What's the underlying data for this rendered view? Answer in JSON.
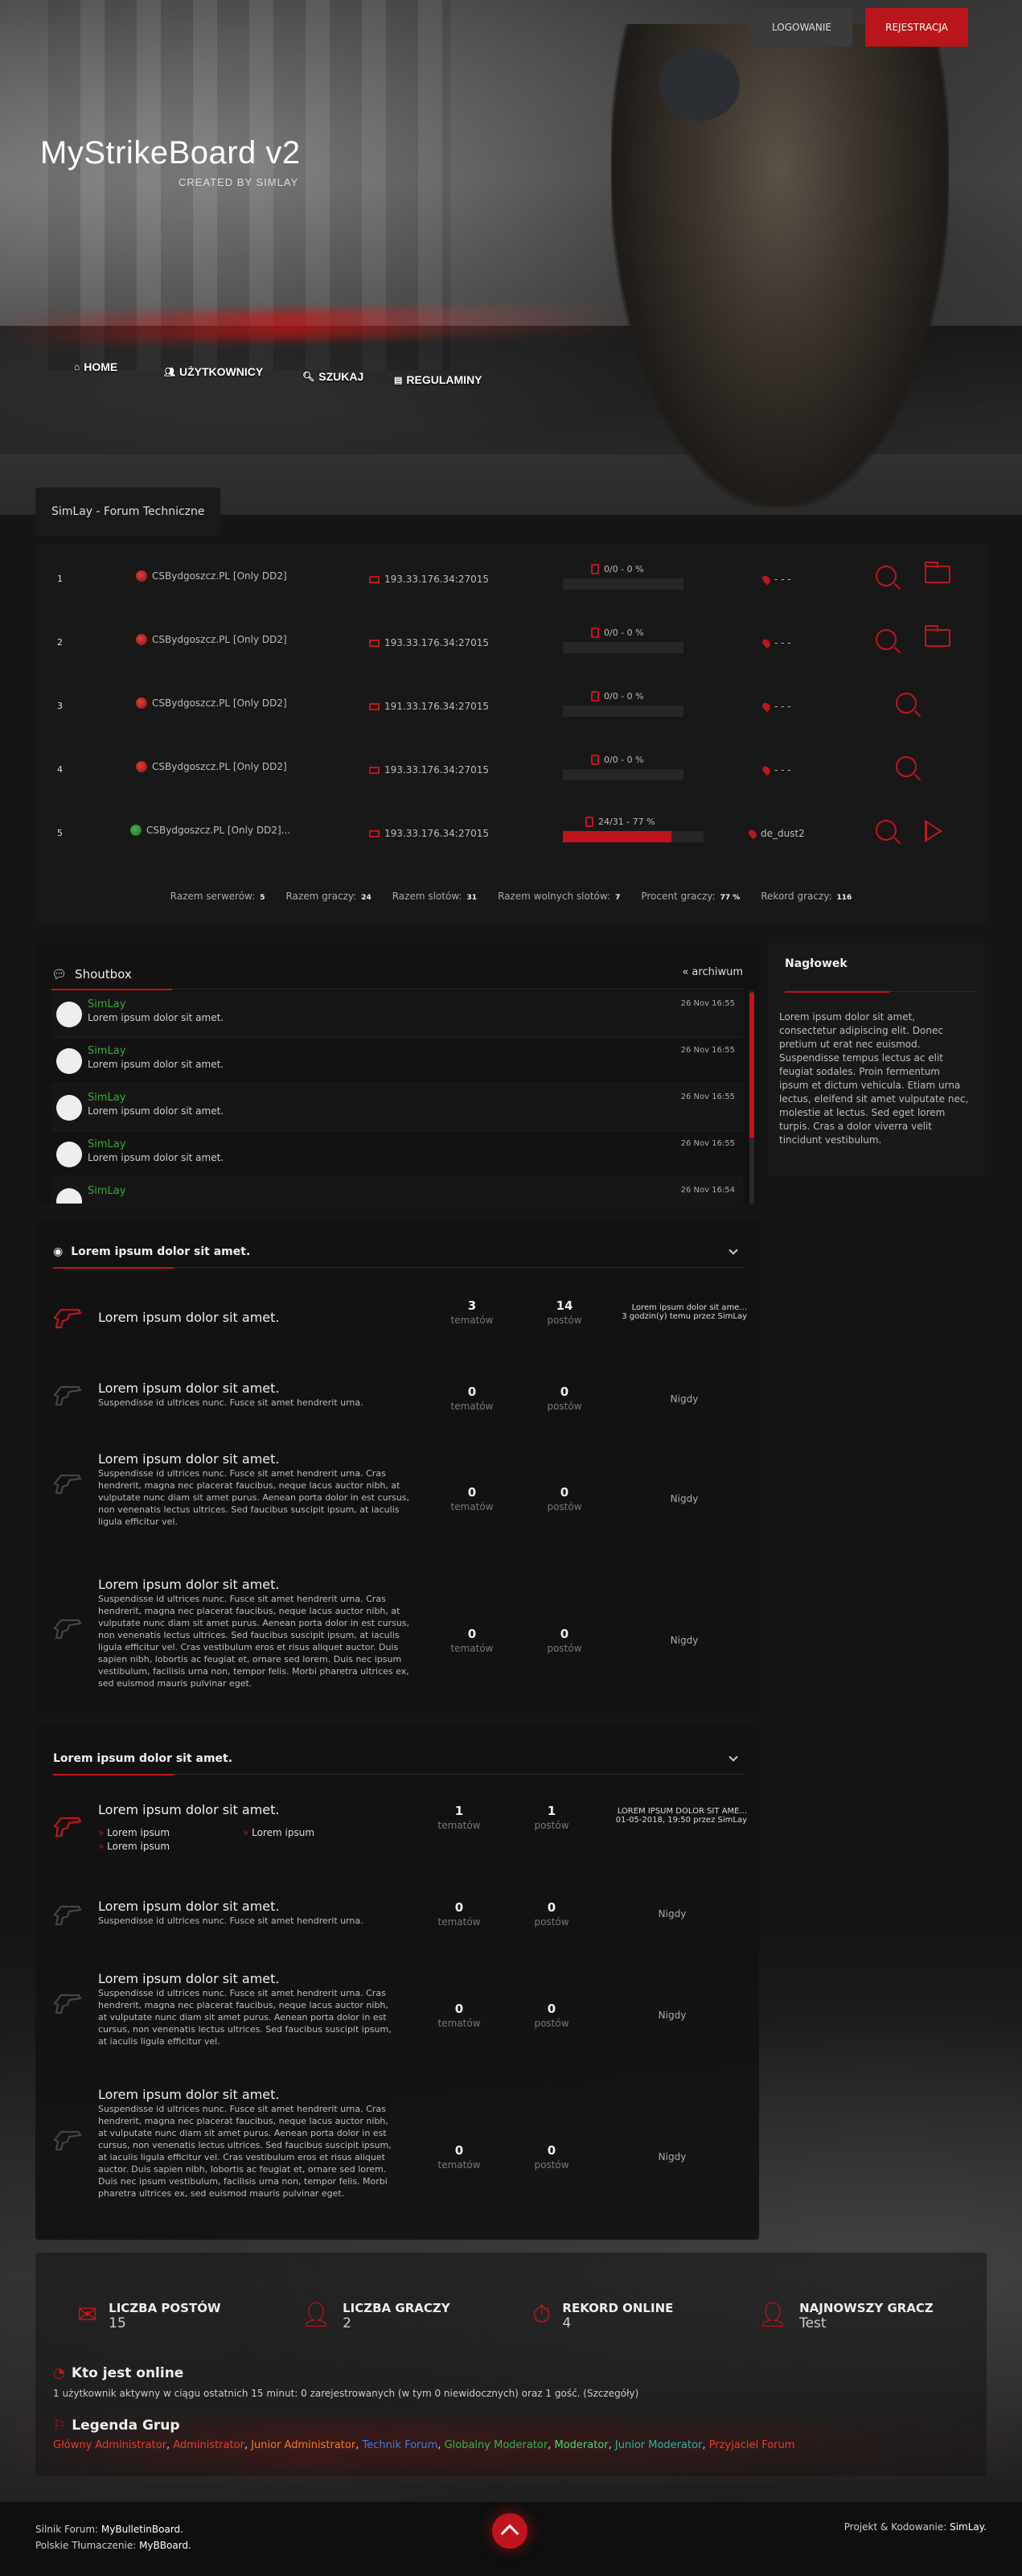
{
  "header": {
    "logo": "MyStrikeBoard v2",
    "logo_sub": "CREATED BY SIMLAY",
    "login": "LOGOWANIE",
    "register": "REJESTRACJA",
    "nav": [
      "HOME",
      "UŻYTKOWNICY",
      "SZUKAJ",
      "REGULAMINY"
    ],
    "breadcrumb": "SimLay - Forum Techniczne"
  },
  "servers": [
    {
      "num": "1",
      "name": "CSBydgoszcz.PL [Only DD2]",
      "ip": "193.33.176.34:27015",
      "slots": "0/0 - 0 %",
      "fill": 0,
      "map": "- - -",
      "flag": "red"
    },
    {
      "num": "2",
      "name": "CSBydgoszcz.PL [Only DD2]",
      "ip": "193.33.176.34:27015",
      "slots": "0/0 - 0 %",
      "fill": 0,
      "map": "- - -",
      "flag": "red"
    },
    {
      "num": "3",
      "name": "CSBydgoszcz.PL [Only DD2]",
      "ip": "191.33.176.34:27015",
      "slots": "0/0 - 0 %",
      "fill": 0,
      "map": "- - -",
      "flag": "red"
    },
    {
      "num": "4",
      "name": "CSBydgoszcz.PL [Only DD2]",
      "ip": "193.33.176.34:27015",
      "slots": "0/0 - 0 %",
      "fill": 0,
      "map": "- - -",
      "flag": "red"
    },
    {
      "num": "5",
      "name": "CSBydgoszcz.PL [Only DD2]...",
      "ip": "193.33.176.34:27015",
      "slots": "24/31 - 77 %",
      "fill": 77,
      "map": "de_dust2",
      "flag": "green"
    }
  ],
  "totals": [
    {
      "label": "Razem serwerów:",
      "value": "5"
    },
    {
      "label": "Razem graczy:",
      "value": "24"
    },
    {
      "label": "Razem slotów:",
      "value": "31"
    },
    {
      "label": "Razem wolnych slotów:",
      "value": "7"
    },
    {
      "label": "Procent graczy:",
      "value": "77 %"
    },
    {
      "label": "Rekord graczy:",
      "value": "116"
    }
  ],
  "shoutbox": {
    "title": "Shoutbox",
    "archive": "« archiwum",
    "messages": [
      {
        "user": "SimLay",
        "text": "Lorem ipsum dolor sit amet.",
        "date": "26 Nov 16:55"
      },
      {
        "user": "SimLay",
        "text": "Lorem ipsum dolor sit amet.",
        "date": "26 Nov 16:55"
      },
      {
        "user": "SimLay",
        "text": "Lorem ipsum dolor sit amet.",
        "date": "26 Nov 16:55"
      },
      {
        "user": "SimLay",
        "text": "Lorem ipsum dolor sit amet.",
        "date": "26 Nov 16:55"
      },
      {
        "user": "SimLay",
        "text": "",
        "date": "26 Nov 16:54"
      }
    ]
  },
  "sidebar": {
    "title": "Nagłowek",
    "text": "Lorem ipsum dolor sit amet, consectetur adipiscing elit. Donec pretium ut erat nec euismod. Suspendisse tempus lectus ac elit feugiat sodales. Proin fermentum ipsum et dictum vehicula. Etiam urna lectus, eleifend sit amet vulputate nec, molestie at lectus. Sed eget lorem turpis. Cras a dolor viverra velit tincidunt vestibulum."
  },
  "labels": {
    "topics": "tematów",
    "posts": "postów",
    "never": "Nigdy"
  },
  "categories": [
    {
      "title": "Lorem ipsum dolor sit amet.",
      "forums": [
        {
          "title": "Lorem ipsum dolor sit amet.",
          "desc": "",
          "topics": "3",
          "posts": "14",
          "last_title": "Lorem ipsum dolor sit ame...",
          "last_meta": "3 godzin(y) temu",
          "last_by": "przez",
          "last_user": "SimLay",
          "active": true
        },
        {
          "title": "Lorem ipsum dolor sit amet.",
          "desc": "Suspendisse id ultrices nunc. Fusce sit amet hendrerit urna.",
          "topics": "0",
          "posts": "0",
          "active": false
        },
        {
          "title": "Lorem ipsum dolor sit amet.",
          "desc": "Suspendisse id ultrices nunc. Fusce sit amet hendrerit urna. Cras hendrerit, magna nec placerat faucibus, neque lacus auctor nibh, at vulputate nunc diam sit amet purus. Aenean porta dolor in est cursus, non venenatis lectus ultrices. Sed faucibus suscipit ipsum, at iaculis ligula efficitur vel.",
          "topics": "0",
          "posts": "0",
          "active": false
        },
        {
          "title": "Lorem ipsum dolor sit amet.",
          "desc": "Suspendisse id ultrices nunc. Fusce sit amet hendrerit urna. Cras hendrerit, magna nec placerat faucibus, neque lacus auctor nibh, at vulputate nunc diam sit amet purus. Aenean porta dolor in est cursus, non venenatis lectus ultrices. Sed faucibus suscipit ipsum, at iaculis ligula efficitur vel. Cras vestibulum eros et risus aliquet auctor. Duis sapien nibh, lobortis ac feugiat et, ornare sed lorem. Duis nec ipsum vestibulum, facilisis urna non, tempor felis. Morbi pharetra ultrices ex, sed euismod mauris pulvinar eget.",
          "topics": "0",
          "posts": "0",
          "active": false
        }
      ]
    },
    {
      "title": "Lorem ipsum dolor sit amet.",
      "forums": [
        {
          "title": "Lorem ipsum dolor sit amet.",
          "desc": "",
          "topics": "1",
          "posts": "1",
          "last_title": "LOREM IPSUM DOLOR SIT AME...",
          "last_meta": "01-05-2018, 19:50",
          "last_by": "przez",
          "last_user": "SimLay",
          "active": true,
          "sub": [
            "Lorem ipsum",
            "Lorem ipsum",
            "Lorem ipsum"
          ]
        },
        {
          "title": "Lorem ipsum dolor sit amet.",
          "desc": "Suspendisse id ultrices nunc. Fusce sit amet hendrerit urna.",
          "topics": "0",
          "posts": "0",
          "active": false
        },
        {
          "title": "Lorem ipsum dolor sit amet.",
          "desc": "Suspendisse id ultrices nunc. Fusce sit amet hendrerit urna. Cras hendrerit, magna nec placerat faucibus, neque lacus auctor nibh, at vulputate nunc diam sit amet purus. Aenean porta dolor in est cursus, non venenatis lectus ultrices. Sed faucibus suscipit ipsum, at iaculis ligula efficitur vel.",
          "topics": "0",
          "posts": "0",
          "active": false
        },
        {
          "title": "Lorem ipsum dolor sit amet.",
          "desc": "Suspendisse id ultrices nunc. Fusce sit amet hendrerit urna. Cras hendrerit, magna nec placerat faucibus, neque lacus auctor nibh, at vulputate nunc diam sit amet purus. Aenean porta dolor in est cursus, non venenatis lectus ultrices. Sed faucibus suscipit ipsum, at iaculis ligula efficitur vel. Cras vestibulum eros et risus aliquet auctor. Duis sapien nibh, lobortis ac feugiat et, ornare sed lorem. Duis nec ipsum vestibulum, facilisis urna non, tempor felis. Morbi pharetra ultrices ex, sed euismod mauris pulvinar eget.",
          "topics": "0",
          "posts": "0",
          "active": false
        }
      ]
    }
  ],
  "stats": {
    "posts_label": "LICZBA POSTÓW",
    "posts": "15",
    "players_label": "LICZBA GRACZY",
    "players": "2",
    "record_label": "REKORD ONLINE",
    "record": "4",
    "newest_label": "NAJNOWSZY GRACZ",
    "newest": "Test",
    "online_title": "Kto jest online",
    "online_desc": "1 użytkownik aktywny w ciągu ostatnich 15 minut: 0 zarejestrowanych (w tym 0 niewidocznych) oraz 1 gość. (Szczegóły)",
    "legend_title": "Legenda Grup",
    "groups": [
      {
        "name": "Główny Administrator",
        "color": "#e8392f"
      },
      {
        "name": "Administrator",
        "color": "#e8392f"
      },
      {
        "name": "Junior Administrator",
        "color": "#f07b1e"
      },
      {
        "name": "Technik Forum",
        "color": "#3b7dd8"
      },
      {
        "name": "Globalny Moderator",
        "color": "#2fb34a"
      },
      {
        "name": "Moderator",
        "color": "#4fd36a"
      },
      {
        "name": "Junior Moderator",
        "color": "#27b7a0"
      },
      {
        "name": "Przyjaciel Forum",
        "color": "#e8392f"
      }
    ]
  },
  "footer": {
    "engine_label": "Silnik Forum:",
    "engine": "MyBulletinBoard.",
    "pl_label": "Polskie Tłumaczenie:",
    "pl": "MyBBoard.",
    "design_label": "Projekt & Kodowanie:",
    "design": "SimLay."
  },
  "colors": {
    "accent": "#c0141c",
    "user_green": "#38a838"
  }
}
